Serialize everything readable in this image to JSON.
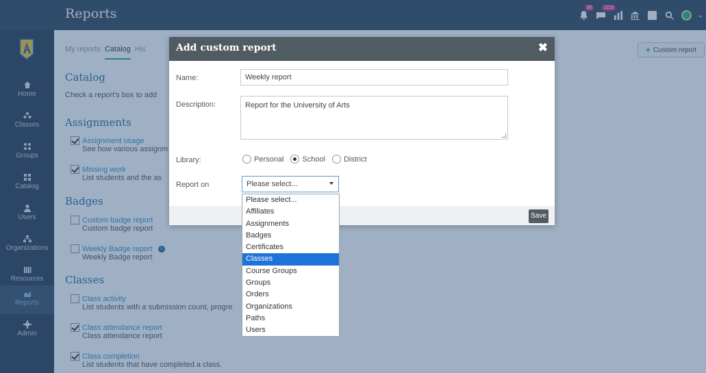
{
  "header": {
    "title": "Reports",
    "badge_1": "30",
    "badge_2": "1115"
  },
  "sidebar": {
    "items": [
      {
        "label": "Home",
        "icon": "home-icon"
      },
      {
        "label": "Classes",
        "icon": "classes-icon"
      },
      {
        "label": "Groups",
        "icon": "groups-icon"
      },
      {
        "label": "Catalog",
        "icon": "catalog-icon"
      },
      {
        "label": "Users",
        "icon": "users-icon"
      },
      {
        "label": "Organizations",
        "icon": "organizations-icon"
      },
      {
        "label": "Resources",
        "icon": "resources-icon"
      },
      {
        "label": "Reports",
        "icon": "reports-icon"
      },
      {
        "label": "Admin",
        "icon": "admin-icon"
      }
    ]
  },
  "tabs": [
    "My reports",
    "Catalog",
    "His"
  ],
  "custom_report_button": "Custom report",
  "catalog": {
    "title": "Catalog",
    "text": "Check a report's box to add"
  },
  "sections": {
    "assignments": {
      "title": "Assignments",
      "reports": [
        {
          "name": "Assignment usage",
          "desc": "See how various assignm",
          "checked": true
        },
        {
          "name": "Missing work",
          "desc": "List students and the as",
          "checked": true
        }
      ]
    },
    "badges": {
      "title": "Badges",
      "reports": [
        {
          "name": "Custom badge report",
          "desc": "Custom badge report",
          "checked": false
        },
        {
          "name": "Weekly Badge report",
          "desc": "Weekly Badge report",
          "checked": false
        }
      ]
    },
    "classes": {
      "title": "Classes",
      "reports": [
        {
          "name": "Class activity",
          "desc": "List students with a submission count, progre",
          "checked": false
        },
        {
          "name": "Class attendance report",
          "desc": "Class attendance report",
          "checked": true
        },
        {
          "name": "Class completion",
          "desc": "List students that have completed a class.",
          "checked": true
        }
      ]
    }
  },
  "modal": {
    "title": "Add custom report",
    "close": "✖",
    "name_label": "Name:",
    "name_value": "Weekly report",
    "description_label": "Description:",
    "description_value": "Report for the University of Arts",
    "library_label": "Library:",
    "library_options": [
      "Personal",
      "School",
      "District"
    ],
    "library_selected": "School",
    "report_on_label": "Report on",
    "report_on_value": "Please select...",
    "save_label": "Save"
  },
  "dropdown": {
    "options": [
      "Please select...",
      "Affiliates",
      "Assignments",
      "Badges",
      "Certificates",
      "Classes",
      "Course Groups",
      "Groups",
      "Orders",
      "Organizations",
      "Paths",
      "Users"
    ],
    "highlighted": "Classes"
  },
  "colors": {
    "topbar": "#36495e",
    "sidebar": "#2e4053",
    "modal_header": "#515b62",
    "link": "#3a8fc8",
    "heading": "#2a6e9e",
    "highlight": "#1e73d9"
  }
}
